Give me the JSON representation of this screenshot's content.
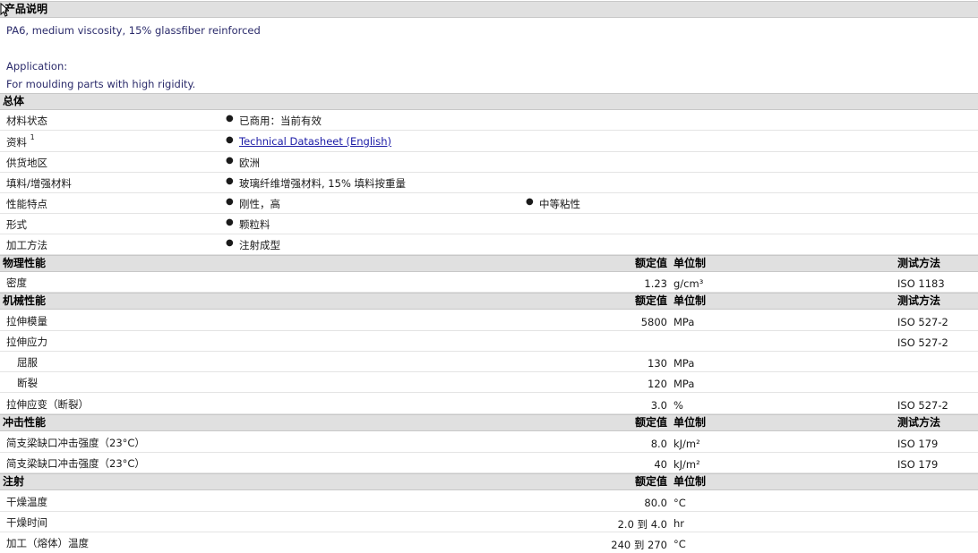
{
  "sections": {
    "desc": {
      "title": "产品说明"
    },
    "general": {
      "title": "总体"
    },
    "physical": {
      "title": "物理性能",
      "nominal": "额定值",
      "unit": "单位制",
      "method": "测试方法"
    },
    "mechanical": {
      "title": "机械性能",
      "nominal": "额定值",
      "unit": "单位制",
      "method": "测试方法"
    },
    "impact": {
      "title": "冲击性能",
      "nominal": "额定值",
      "unit": "单位制",
      "method": "测试方法"
    },
    "injection": {
      "title": "注射",
      "nominal": "额定值",
      "unit": "单位制"
    }
  },
  "description": {
    "line1": "PA6, medium viscosity, 15% glassfiber reinforced",
    "line2": "Application:",
    "line3": "For moulding parts with high rigidity."
  },
  "general": [
    {
      "label": "材料状态",
      "values": [
        "已商用：当前有效"
      ]
    },
    {
      "label": "资料",
      "sup": "1",
      "values": [
        "Technical Datasheet (English)"
      ]
    },
    {
      "label": "供货地区",
      "values": [
        "欧洲"
      ]
    },
    {
      "label": "填料/增强材料",
      "values": [
        "玻璃纤维增强材料, 15% 填料按重量"
      ]
    },
    {
      "label": "性能特点",
      "values": [
        "刚性，高",
        "中等粘性"
      ]
    },
    {
      "label": "形式",
      "values": [
        "颗粒料"
      ]
    },
    {
      "label": "加工方法",
      "values": [
        "注射成型"
      ]
    }
  ],
  "physical": [
    {
      "label": "密度",
      "value": "1.23",
      "unit": "g/cm³",
      "method": "ISO 1183"
    }
  ],
  "mechanical": [
    {
      "label": "拉伸模量",
      "value": "5800",
      "unit": "MPa",
      "method": "ISO 527-2"
    },
    {
      "label": "拉伸应力",
      "value": "",
      "unit": "",
      "method": "ISO 527-2"
    },
    {
      "label": "屈服",
      "value": "130",
      "unit": "MPa",
      "method": ""
    },
    {
      "label": "断裂",
      "value": "120",
      "unit": "MPa",
      "method": ""
    },
    {
      "label": "拉伸应变（断裂）",
      "value": "3.0",
      "unit": "%",
      "method": "ISO 527-2"
    }
  ],
  "impact": [
    {
      "label": "简支梁缺口冲击强度（23°C）",
      "value": "8.0",
      "unit": "kJ/m²",
      "method": "ISO 179"
    },
    {
      "label": "简支梁缺口冲击强度（23°C）",
      "value": "40",
      "unit": "kJ/m²",
      "method": "ISO 179"
    }
  ],
  "injection": [
    {
      "label": "干燥温度",
      "value": "80.0",
      "unit": "°C"
    },
    {
      "label": "干燥时间",
      "value": "2.0 到  4.0",
      "unit": "hr"
    },
    {
      "label": "加工（熔体）温度",
      "value": "240 到  270",
      "unit": "°C"
    }
  ]
}
